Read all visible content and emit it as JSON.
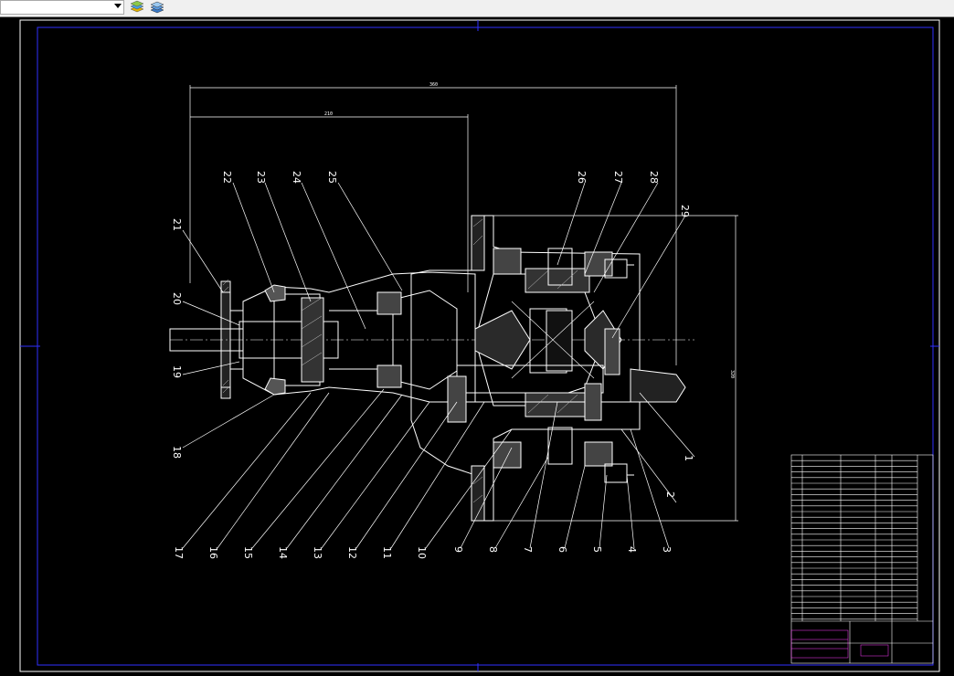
{
  "toolbar": {
    "layer_dropdown_value": "",
    "icons": [
      "layer-states-icon",
      "layer-stack-icon"
    ]
  },
  "drawing": {
    "part_numbers_top": [
      "22",
      "23",
      "24",
      "25",
      "26",
      "27",
      "28",
      "29"
    ],
    "part_numbers_left": [
      "21",
      "20",
      "19",
      "18"
    ],
    "part_numbers_bottom": [
      "17",
      "16",
      "15",
      "14",
      "13",
      "12",
      "11",
      "10",
      "9",
      "8",
      "7",
      "6",
      "5",
      "4",
      "3"
    ],
    "part_numbers_right": [
      "1",
      "2"
    ],
    "dim_overall": "360",
    "dim_upper": "210",
    "dim_height": "320",
    "colors": {
      "lines": "#ffffff",
      "frame": "#0000ff",
      "title_text": "#ff3cff",
      "hatch": "#c8c8c8"
    }
  }
}
